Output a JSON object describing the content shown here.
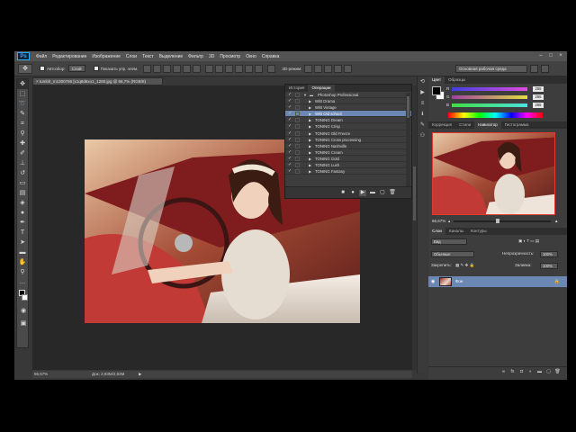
{
  "app": {
    "logo": "Ps",
    "menu": [
      "Файл",
      "Редактирование",
      "Изображение",
      "Слои",
      "Текст",
      "Выделение",
      "Фильтр",
      "3D",
      "Просмотр",
      "Окно",
      "Справка"
    ]
  },
  "options": {
    "antialias_label": "Автозбор:",
    "group_select": "Слой",
    "show_controls_label": "Показать упр. элем.",
    "mode_3d_label": "3D-режим:",
    "workspace": "Основная рабочая среда"
  },
  "document": {
    "tab_title": "tumblr_m1300786 [x1q8d6xo1_1280.jpg @ 66,7% (RGB/8)",
    "zoom": "66,67%",
    "doc_size": "Док: 2,93M/2,93M"
  },
  "actions_panel": {
    "tabs": [
      "История",
      "Операции"
    ],
    "items": [
      {
        "label": "Photoshop Professional",
        "level": 0,
        "checked": true,
        "expanded": true,
        "selected": false
      },
      {
        "label": "W/B Drama",
        "level": 1,
        "checked": true,
        "expanded": false,
        "selected": false
      },
      {
        "label": "W/B Vintage",
        "level": 1,
        "checked": true,
        "expanded": false,
        "selected": false
      },
      {
        "label": "W/B Old school",
        "level": 1,
        "checked": true,
        "expanded": false,
        "selected": true
      },
      {
        "label": "TONING Dream",
        "level": 1,
        "checked": true,
        "expanded": false,
        "selected": false
      },
      {
        "label": "TONING Crisp",
        "level": 1,
        "checked": true,
        "expanded": false,
        "selected": false
      },
      {
        "label": "TONING Old Freeze",
        "level": 1,
        "checked": true,
        "expanded": false,
        "selected": false
      },
      {
        "label": "TONING Cross processing",
        "level": 1,
        "checked": true,
        "expanded": false,
        "selected": false
      },
      {
        "label": "TONING Nashville",
        "level": 1,
        "checked": true,
        "expanded": false,
        "selected": false
      },
      {
        "label": "TONING Cream",
        "level": 1,
        "checked": true,
        "expanded": false,
        "selected": false
      },
      {
        "label": "TONING Gold",
        "level": 1,
        "checked": true,
        "expanded": false,
        "selected": false
      },
      {
        "label": "TONING Lush",
        "level": 1,
        "checked": true,
        "expanded": false,
        "selected": false
      },
      {
        "label": "TONING Fantasy",
        "level": 1,
        "checked": true,
        "expanded": false,
        "selected": false
      }
    ]
  },
  "color_panel": {
    "tabs": [
      "Цвет",
      "Образцы"
    ],
    "channels": [
      {
        "name": "R",
        "value": "255"
      },
      {
        "name": "G",
        "value": "255"
      },
      {
        "name": "B",
        "value": "255"
      }
    ],
    "colors": {
      "r_bar": "#e04be0",
      "g_bar": "#e0e040",
      "b_bar": "#4be0e0"
    }
  },
  "navigator_panel": {
    "tabs": [
      "Коррекция",
      "Стили",
      "Навигатор",
      "Гистограмма"
    ],
    "zoom": "66,67%",
    "zoom_fraction": 0.45
  },
  "layers_panel": {
    "tabs": [
      "Слои",
      "Каналы",
      "Контуры"
    ],
    "kind": "Вид",
    "blend_mode": "Обычные",
    "opacity_label": "Непрозрачность:",
    "opacity_value": "100%",
    "lock_label": "Закрепить:",
    "fill_label": "Заливка:",
    "fill_value": "100%",
    "layers": [
      {
        "name": "Фон",
        "visible": true,
        "locked": true
      }
    ]
  },
  "accent": "#6b87b3"
}
